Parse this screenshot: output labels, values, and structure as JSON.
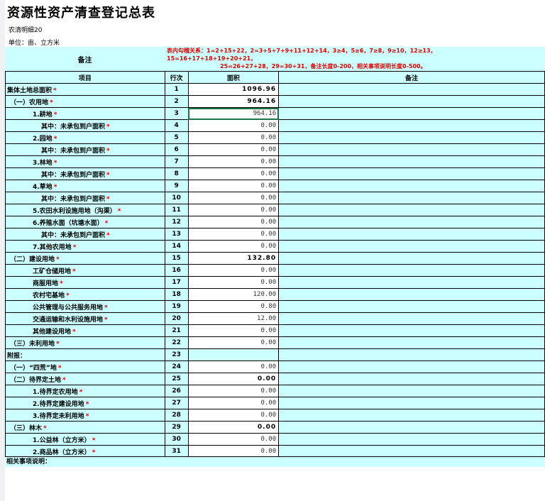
{
  "title": "资源性资产清查登记总表",
  "subtitle": "农清明细20",
  "unit": "单位：亩、立方米",
  "header": {
    "beizhu": "备注",
    "rules_line1": "表内勾稽关系：1=2+15+22，2=3+5+7+9+11+12+14，3≥4，5≥6，7≥8，9≥10，12≥13，",
    "rules_line2": "15=16+17+18+19+20+21，",
    "rules_line3": "25=26+27+28，29=30+31，备注长度0-200，相关事项说明长度0-500。"
  },
  "columns": {
    "item": "项目",
    "no": "行次",
    "area": "面积",
    "note": "备注"
  },
  "rows": [
    {
      "label": "集体土地总面积",
      "star": "*",
      "no": "1",
      "area": "1096.96",
      "indent": "i0",
      "type": "total"
    },
    {
      "label": "（一）农用地",
      "star": "*",
      "no": "2",
      "area": "964.16",
      "indent": "i1",
      "type": "total"
    },
    {
      "label": "1.耕地",
      "star": "*",
      "no": "3",
      "area": "964.16",
      "indent": "i2",
      "type": "blue",
      "selected": true
    },
    {
      "label": "其中：未承包到户面积",
      "star": "*",
      "no": "4",
      "area": "0.00",
      "indent": "i3",
      "type": "blue"
    },
    {
      "label": "2.园地",
      "star": "*",
      "no": "5",
      "area": "0.00",
      "indent": "i2",
      "type": "blue"
    },
    {
      "label": "其中：未承包到户面积",
      "star": "*",
      "no": "6",
      "area": "0.00",
      "indent": "i3",
      "type": "blue"
    },
    {
      "label": "3.林地",
      "star": "*",
      "no": "7",
      "area": "0.00",
      "indent": "i2",
      "type": "blue"
    },
    {
      "label": "其中：未承包到户面积",
      "star": "*",
      "no": "8",
      "area": "0.00",
      "indent": "i3",
      "type": "blue"
    },
    {
      "label": "4.草地",
      "star": "*",
      "no": "9",
      "area": "0.00",
      "indent": "i2",
      "type": "blue"
    },
    {
      "label": "其中：未承包到户面积",
      "star": "*",
      "no": "10",
      "area": "0.00",
      "indent": "i3",
      "type": "blue"
    },
    {
      "label": "5.农田水利设施用地（沟渠）",
      "star": "*",
      "no": "11",
      "area": "0.00",
      "indent": "i2",
      "type": "blue"
    },
    {
      "label": "6.养殖水面（坑塘水面）",
      "star": "*",
      "no": "12",
      "area": "0.00",
      "indent": "i2",
      "type": "blue"
    },
    {
      "label": "其中：未承包到户面积",
      "star": "*",
      "no": "13",
      "area": "0.00",
      "indent": "i3",
      "type": "blue"
    },
    {
      "label": "7.其他农用地",
      "star": "*",
      "no": "14",
      "area": "0.00",
      "indent": "i2",
      "type": "blue"
    },
    {
      "label": "（二）建设用地",
      "star": "*",
      "no": "15",
      "area": "132.80",
      "indent": "i1",
      "type": "total"
    },
    {
      "label": "工矿仓储用地",
      "star": "*",
      "no": "16",
      "area": "0.00",
      "indent": "i2",
      "type": "blue"
    },
    {
      "label": "商服用地",
      "star": "*",
      "no": "17",
      "area": "0.00",
      "indent": "i2",
      "type": "blue"
    },
    {
      "label": "农村宅基地",
      "star": "*",
      "no": "18",
      "area": "120.00",
      "indent": "i2",
      "type": "blue"
    },
    {
      "label": "公共管理与公共服务用地",
      "star": "*",
      "no": "19",
      "area": "0.80",
      "indent": "i2",
      "type": "blue"
    },
    {
      "label": "交通运输和水利设施用地",
      "star": "*",
      "no": "20",
      "area": "12.00",
      "indent": "i2",
      "type": "blue"
    },
    {
      "label": "其他建设用地",
      "star": "*",
      "no": "21",
      "area": "0.00",
      "indent": "i2",
      "type": "blue"
    },
    {
      "label": "（三）未利用地",
      "star": "*",
      "no": "22",
      "area": "0.00",
      "indent": "i1",
      "type": "blue"
    },
    {
      "label": "附报：",
      "star": "",
      "no": "23",
      "area": "",
      "indent": "i0",
      "type": "full"
    },
    {
      "label": "（一）“四荒”地",
      "star": "*",
      "no": "24",
      "area": "0.00",
      "indent": "i1",
      "type": "blue"
    },
    {
      "label": "（二）待界定土地",
      "star": "*",
      "no": "25",
      "area": "0.00",
      "indent": "i1",
      "type": "total"
    },
    {
      "label": "1.待界定农用地",
      "star": "*",
      "no": "26",
      "area": "0.00",
      "indent": "i2",
      "type": "blue"
    },
    {
      "label": "2.待界定建设用地",
      "star": "*",
      "no": "27",
      "area": "0.00",
      "indent": "i2",
      "type": "blue"
    },
    {
      "label": "3.待界定未利用地",
      "star": "*",
      "no": "28",
      "area": "0.00",
      "indent": "i2",
      "type": "blue"
    },
    {
      "label": "（三）林木",
      "star": "*",
      "no": "29",
      "area": "0.00",
      "indent": "i1",
      "type": "total"
    },
    {
      "label": "1.公益林（立方米）",
      "star": "*",
      "no": "30",
      "area": "0.00",
      "indent": "i2",
      "type": "blue"
    },
    {
      "label": "2.商品林（立方米）",
      "star": "*",
      "no": "31",
      "area": "0.00",
      "indent": "i2",
      "type": "blue"
    }
  ],
  "footer": "相关事项说明："
}
